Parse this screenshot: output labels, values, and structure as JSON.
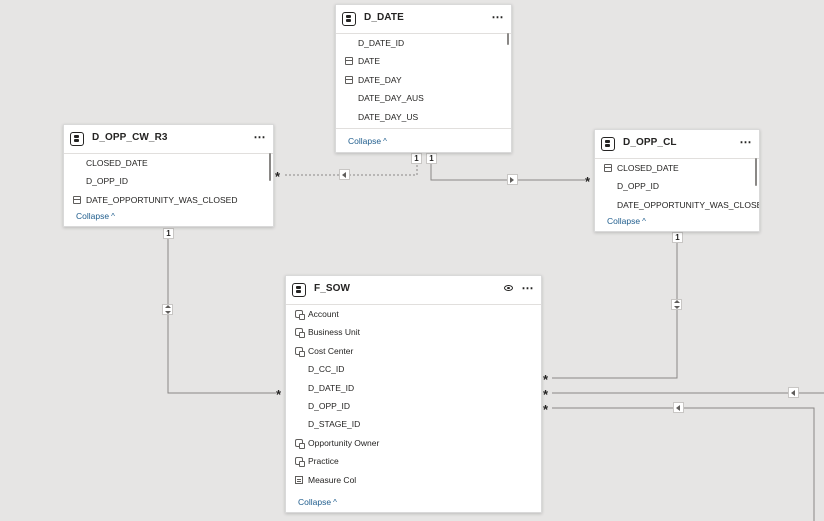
{
  "tables": {
    "d_date": {
      "title": "D_DATE",
      "fields": [
        "D_DATE_ID",
        "DATE",
        "DATE_DAY",
        "DATE_DAY_AUS",
        "DATE_DAY_US"
      ],
      "field_icons": [
        "none",
        "calendar-icon",
        "calendar-icon",
        "none",
        "none"
      ],
      "collapse_label": "Collapse"
    },
    "d_opp_cw_r3": {
      "title": "D_OPP_CW_R3",
      "fields": [
        "CLOSED_DATE",
        "D_OPP_ID",
        "DATE_OPPORTUNITY_WAS_CLOSED"
      ],
      "field_icons": [
        "none",
        "none",
        "calendar-icon"
      ],
      "collapse_label": "Collapse"
    },
    "d_opp_cl": {
      "title": "D_OPP_CL",
      "fields": [
        "CLOSED_DATE",
        "D_OPP_ID",
        "DATE_OPPORTUNITY_WAS_CLOSED"
      ],
      "field_icons": [
        "calendar-icon",
        "none",
        "none"
      ],
      "collapse_label": "Collapse"
    },
    "f_sow": {
      "title": "F_SOW",
      "fields": [
        "Account",
        "Business Unit",
        "Cost Center",
        "D_CC_ID",
        "D_DATE_ID",
        "D_OPP_ID",
        "D_STAGE_ID",
        "Opportunity Owner",
        "Practice",
        "Measure Col"
      ],
      "field_icons": [
        "hierarchy-icon",
        "hierarchy-icon",
        "hierarchy-icon",
        "none",
        "none",
        "none",
        "none",
        "hierarchy-icon",
        "hierarchy-icon",
        "calculator-icon"
      ],
      "collapse_label": "Collapse"
    }
  },
  "cardinality": {
    "one": "1",
    "many": "*"
  },
  "icons": {
    "more": "⋯",
    "chevron_up": "^",
    "view": "eye-icon"
  },
  "colors": {
    "canvas": "#e6e5e4",
    "card": "#ffffff",
    "relationship_line": "#8a8886",
    "collapse_link": "#1f5d8d"
  }
}
